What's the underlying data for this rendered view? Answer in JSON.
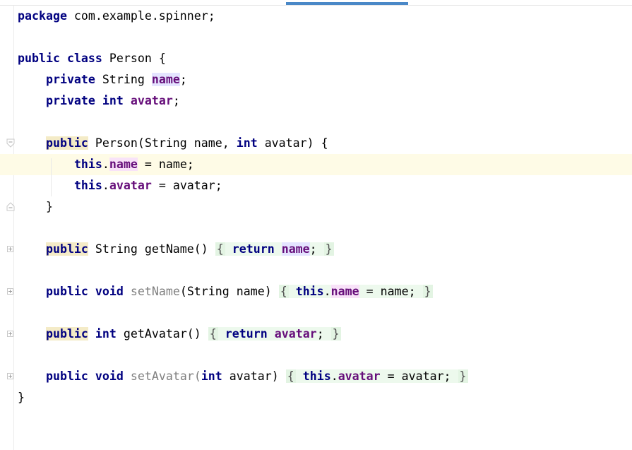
{
  "editor": {
    "lines": [
      {
        "row": 0,
        "segments": [
          {
            "t": "package",
            "c": "kw"
          },
          {
            "t": " com.example.spinner;",
            "c": ""
          }
        ]
      },
      {
        "row": 1,
        "segments": []
      },
      {
        "row": 2,
        "segments": [
          {
            "t": "public",
            "c": "kw"
          },
          {
            "t": " ",
            "c": ""
          },
          {
            "t": "class",
            "c": "kw"
          },
          {
            "t": " Person {",
            "c": ""
          }
        ]
      },
      {
        "row": 3,
        "segments": [
          {
            "t": "    ",
            "c": ""
          },
          {
            "t": "private",
            "c": "kw"
          },
          {
            "t": " String ",
            "c": ""
          },
          {
            "t": "name",
            "c": "fld hl-field"
          },
          {
            "t": ";",
            "c": ""
          }
        ]
      },
      {
        "row": 4,
        "segments": [
          {
            "t": "    ",
            "c": ""
          },
          {
            "t": "private",
            "c": "kw"
          },
          {
            "t": " ",
            "c": ""
          },
          {
            "t": "int",
            "c": "kw"
          },
          {
            "t": " ",
            "c": ""
          },
          {
            "t": "avatar",
            "c": "fld"
          },
          {
            "t": ";",
            "c": ""
          }
        ]
      },
      {
        "row": 5,
        "segments": []
      },
      {
        "row": 6,
        "segments": [
          {
            "t": "    ",
            "c": ""
          },
          {
            "t": "public",
            "c": "kw hl-kw"
          },
          {
            "t": " Person(String name, ",
            "c": ""
          },
          {
            "t": "int",
            "c": "kw"
          },
          {
            "t": " avatar) {",
            "c": ""
          }
        ]
      },
      {
        "row": 7,
        "caret": true,
        "segments": [
          {
            "t": "        ",
            "c": ""
          },
          {
            "t": "this",
            "c": "kw"
          },
          {
            "t": ".",
            "c": ""
          },
          {
            "t": "name",
            "c": "fld hl-write"
          },
          {
            "t": " = name;",
            "c": ""
          }
        ]
      },
      {
        "row": 8,
        "segments": [
          {
            "t": "        ",
            "c": ""
          },
          {
            "t": "this",
            "c": "kw"
          },
          {
            "t": ".",
            "c": ""
          },
          {
            "t": "avatar",
            "c": "fld"
          },
          {
            "t": " = avatar;",
            "c": ""
          }
        ]
      },
      {
        "row": 9,
        "segments": [
          {
            "t": "    }",
            "c": ""
          }
        ]
      },
      {
        "row": 10,
        "segments": []
      },
      {
        "row": 11,
        "segments": [
          {
            "t": "    ",
            "c": ""
          },
          {
            "t": "public",
            "c": "kw hl-kw"
          },
          {
            "t": " String getName() ",
            "c": ""
          },
          {
            "t": "{",
            "c": "fold-brace"
          },
          {
            "t": " ",
            "c": "fold-body"
          },
          {
            "t": "return",
            "c": "kw fold-body"
          },
          {
            "t": " ",
            "c": "fold-body"
          },
          {
            "t": "name",
            "c": "fld hl-field"
          },
          {
            "t": "; ",
            "c": "fold-body"
          },
          {
            "t": "}",
            "c": "fold-brace"
          }
        ]
      },
      {
        "row": 12,
        "segments": []
      },
      {
        "row": 13,
        "segments": [
          {
            "t": "    ",
            "c": ""
          },
          {
            "t": "public",
            "c": "kw"
          },
          {
            "t": " ",
            "c": ""
          },
          {
            "t": "void",
            "c": "kw"
          },
          {
            "t": " ",
            "c": ""
          },
          {
            "t": "setName",
            "c": "unused"
          },
          {
            "t": "(String name) ",
            "c": ""
          },
          {
            "t": "{",
            "c": "fold-brace"
          },
          {
            "t": " ",
            "c": "fold-body"
          },
          {
            "t": "this",
            "c": "kw fold-body"
          },
          {
            "t": ".",
            "c": "fold-body"
          },
          {
            "t": "name",
            "c": "fld hl-write"
          },
          {
            "t": " = name; ",
            "c": "fold-body"
          },
          {
            "t": "}",
            "c": "fold-brace"
          }
        ]
      },
      {
        "row": 14,
        "segments": []
      },
      {
        "row": 15,
        "segments": [
          {
            "t": "    ",
            "c": ""
          },
          {
            "t": "public",
            "c": "kw hl-kw"
          },
          {
            "t": " ",
            "c": ""
          },
          {
            "t": "int",
            "c": "kw"
          },
          {
            "t": " getAvatar() ",
            "c": ""
          },
          {
            "t": "{",
            "c": "fold-brace"
          },
          {
            "t": " ",
            "c": "fold-body"
          },
          {
            "t": "return",
            "c": "kw fold-body"
          },
          {
            "t": " ",
            "c": "fold-body"
          },
          {
            "t": "avatar",
            "c": "fld fold-body"
          },
          {
            "t": "; ",
            "c": "fold-body"
          },
          {
            "t": "}",
            "c": "fold-brace"
          }
        ]
      },
      {
        "row": 16,
        "segments": []
      },
      {
        "row": 17,
        "segments": [
          {
            "t": "    ",
            "c": ""
          },
          {
            "t": "public",
            "c": "kw"
          },
          {
            "t": " ",
            "c": ""
          },
          {
            "t": "void",
            "c": "kw"
          },
          {
            "t": " ",
            "c": ""
          },
          {
            "t": "setAvatar",
            "c": "unused"
          },
          {
            "t": "(",
            "c": "unused"
          },
          {
            "t": "int",
            "c": "kw"
          },
          {
            "t": " avatar) ",
            "c": ""
          },
          {
            "t": "{",
            "c": "fold-brace"
          },
          {
            "t": " ",
            "c": "fold-body"
          },
          {
            "t": "this",
            "c": "kw fold-body"
          },
          {
            "t": ".",
            "c": "fold-body"
          },
          {
            "t": "avatar",
            "c": "fld fold-body"
          },
          {
            "t": " = avatar; ",
            "c": "fold-body"
          },
          {
            "t": "}",
            "c": "fold-brace"
          }
        ]
      },
      {
        "row": 18,
        "segments": [
          {
            "t": "}",
            "c": ""
          }
        ]
      }
    ]
  }
}
